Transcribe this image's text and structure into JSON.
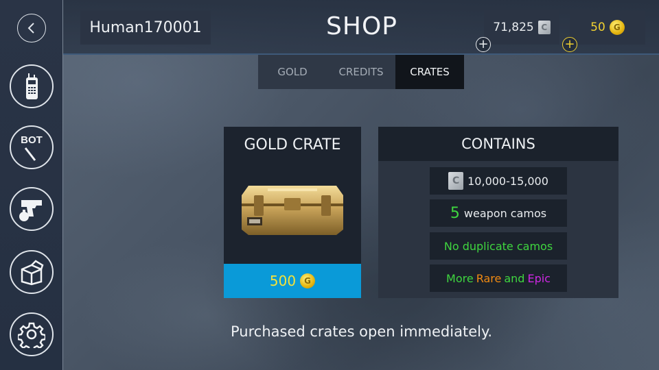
{
  "header": {
    "player_name": "Human170001",
    "title": "SHOP",
    "credits": "71,825",
    "gold": "50",
    "credit_icon_glyph": "C",
    "gold_icon_glyph": "G"
  },
  "sidebar": {
    "items": [
      {
        "name": "back",
        "icon": "chevron-left-icon"
      },
      {
        "name": "radio",
        "icon": "radio-icon"
      },
      {
        "name": "bot",
        "icon": "bot-icon",
        "label": "BOT"
      },
      {
        "name": "weapons",
        "icon": "pistol-grenade-icon"
      },
      {
        "name": "crates",
        "icon": "box-icon"
      },
      {
        "name": "settings",
        "icon": "gear-icon"
      }
    ]
  },
  "tabs": [
    {
      "label": "GOLD",
      "active": false
    },
    {
      "label": "CREDITS",
      "active": false
    },
    {
      "label": "CRATES",
      "active": true
    }
  ],
  "crate": {
    "title": "GOLD CRATE",
    "price": "500"
  },
  "contains": {
    "title": "CONTAINS",
    "credits_range": "10,000-15,000",
    "camo_count": "5",
    "camo_label": "weapon camos",
    "no_duplicates": "No duplicate camos",
    "more_word": "More",
    "rare_word": "Rare",
    "and_word": "and",
    "epic_word": "Epic"
  },
  "footer": {
    "note": "Purchased crates open immediately."
  },
  "colors": {
    "accent_blue": "#0a9ad8",
    "gold_text": "#f2d230",
    "green": "#3fd63f",
    "orange": "#f08a12",
    "purple": "#cf27e4"
  }
}
